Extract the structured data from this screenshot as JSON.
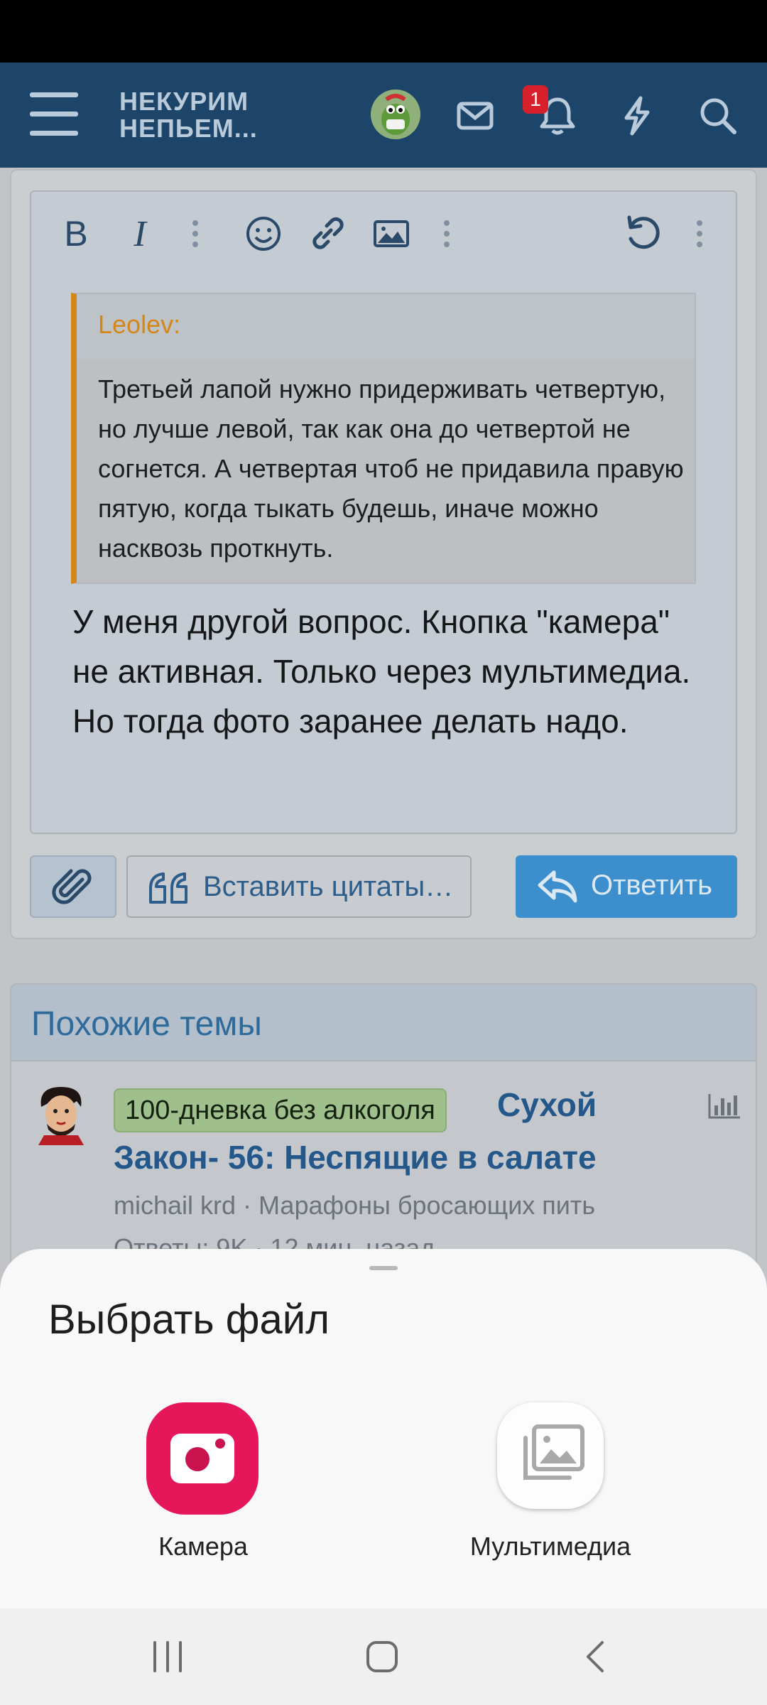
{
  "header": {
    "logo_line1": "НЕКУРИМ",
    "logo_line2": "НЕПЬЕМ...",
    "notification_count": "1",
    "icons": [
      "menu-icon",
      "avatar",
      "mail-icon",
      "bell-icon",
      "bolt-icon",
      "search-icon"
    ]
  },
  "editor": {
    "toolbar_icons": [
      "bold-icon",
      "italic-icon",
      "more-vertical-icon",
      "emoji-icon",
      "link-icon",
      "image-icon",
      "more-vertical-icon",
      "undo-icon",
      "more-vertical-icon"
    ],
    "quote": {
      "author": "Leolev:",
      "text": "Третьей лапой нужно придерживать четвертую, но лучше левой, так как она до четвертой не согнется. А четвертая чтоб не придавила правую пятую, когда тыкать будешь, иначе можно насквозь проткнуть."
    },
    "message": "У меня другой вопрос. Кнопка \"камера\" не активная. Только через мультимедиа. Но тогда фото заранее делать надо."
  },
  "actions": {
    "insert_quotes_label": "Вставить цитаты…",
    "reply_label": "Ответить"
  },
  "similar": {
    "title": "Похожие темы",
    "threads": [
      {
        "prefix": "100-дневка без алкоголя",
        "title_part1": "Сухой",
        "title_part2": "Закон- 56: Неспящие в салате",
        "meta": "michail krd · Марафоны бросающих пить",
        "stats": "Ответы: 9K · 12 мин. назад"
      }
    ]
  },
  "sheet": {
    "title": "Выбрать файл",
    "options": [
      {
        "label": "Камера",
        "icon": "camera-icon",
        "color": "#e5175a"
      },
      {
        "label": "Мультимедиа",
        "icon": "gallery-icon"
      }
    ]
  },
  "colors": {
    "header_bg": "#1d4569",
    "accent": "#3c8fcc",
    "quote_border": "#d48716"
  }
}
